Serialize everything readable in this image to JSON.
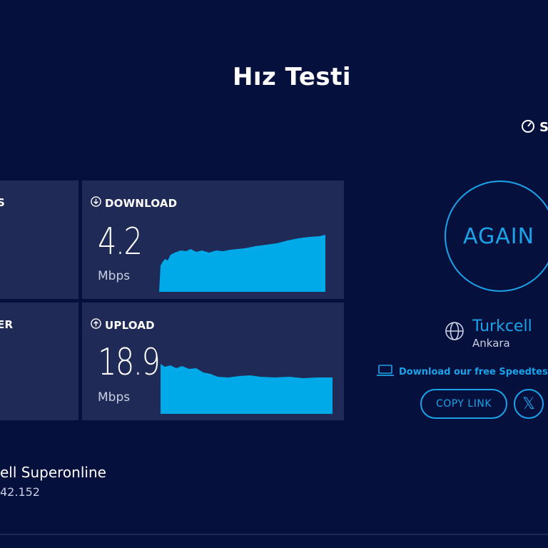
{
  "page": {
    "title": "Hız Testi"
  },
  "top_link": {
    "label": "S",
    "icon": "speedometer-icon"
  },
  "panels": {
    "left_top": {
      "label": "S"
    },
    "left_bottom": {
      "label": "ER"
    },
    "download": {
      "label": "DOWNLOAD",
      "value": "4.2",
      "unit": "Mbps",
      "icon": "download-arrow-icon"
    },
    "upload": {
      "label": "UPLOAD",
      "value": "18.9",
      "unit": "Mbps",
      "icon": "upload-arrow-icon"
    }
  },
  "again": {
    "label": "AGAIN"
  },
  "server": {
    "name": "Turkcell",
    "location": "Ankara",
    "icon": "globe-icon"
  },
  "app_link": {
    "label": "Download our free Speedtest",
    "icon": "laptop-icon"
  },
  "actions": {
    "copy_label": "COPY LINK",
    "x_label": "𝕏"
  },
  "provider": {
    "name": "ell Superonline",
    "ip": "42.152"
  },
  "colors": {
    "background": "#06103d",
    "panel": "#1f2a56",
    "accent": "#1aa3e8",
    "graph": "#00a9e8"
  }
}
